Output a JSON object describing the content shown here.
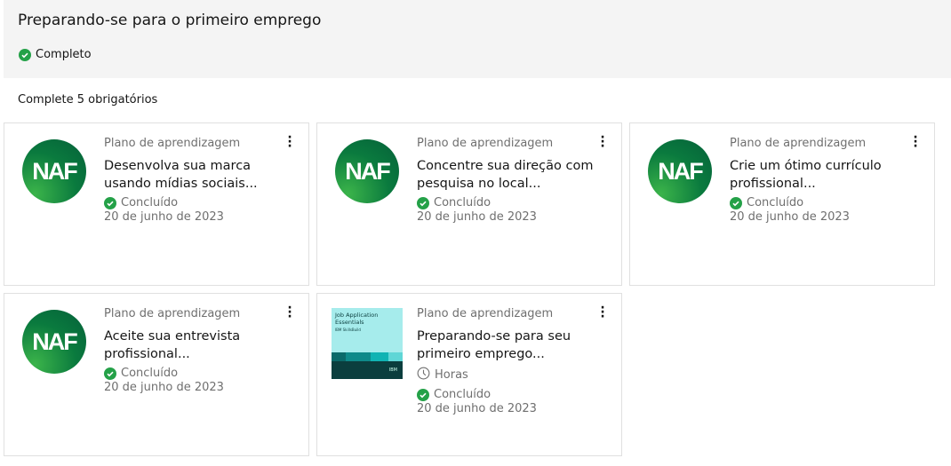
{
  "header": {
    "title": "Preparando-se para o primeiro emprego",
    "status": "Completo"
  },
  "requirement": "Complete 5 obrigatórios",
  "cards": [
    {
      "type": "Plano de aprendizagem",
      "name": "Desenvolva sua marca usando mídias sociais...",
      "status": "Concluído",
      "date": "20 de junho de 2023",
      "logo": "NAF"
    },
    {
      "type": "Plano de aprendizagem",
      "name": "Concentre sua direção com pesquisa no local...",
      "status": "Concluído",
      "date": "20 de junho de 2023",
      "logo": "NAF"
    },
    {
      "type": "Plano de aprendizagem",
      "name": "Crie um ótimo currículo profissional...",
      "status": "Concluído",
      "date": "20 de junho de 2023",
      "logo": "NAF"
    },
    {
      "type": "Plano de aprendizagem",
      "name": "Aceite sua entrevista profissional...",
      "status": "Concluído",
      "date": "20 de junho de 2023",
      "logo": "NAF"
    },
    {
      "type": "Plano de aprendizagem",
      "name": "Preparando-se para seu primeiro emprego...",
      "duration": "Horas",
      "status": "Concluído",
      "date": "20 de junho de 2023",
      "thumb_title": "Job Application Essentials",
      "thumb_sub": "IBM SkillsBuild",
      "thumb_brand": "IBM"
    }
  ],
  "colors": {
    "success": "#24a148",
    "header_bg": "#f4f4f4"
  }
}
